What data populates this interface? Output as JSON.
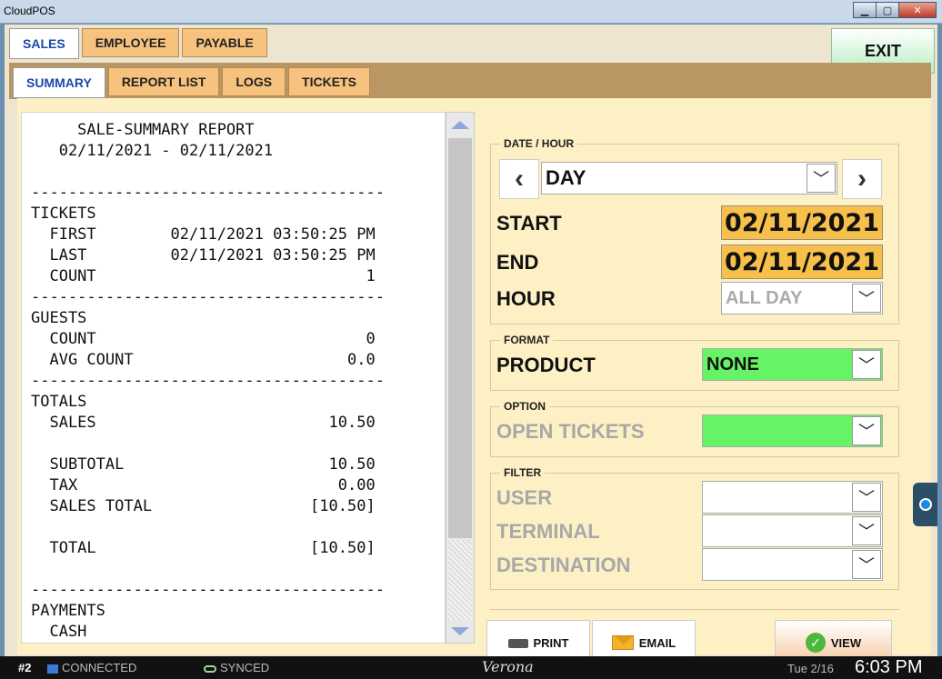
{
  "window": {
    "title": "CloudPOS"
  },
  "top_tabs": [
    {
      "label": "SALES",
      "active": true
    },
    {
      "label": "EMPLOYEE",
      "active": false
    },
    {
      "label": "PAYABLE",
      "active": false
    }
  ],
  "exit_label": "EXIT",
  "sub_tabs": [
    {
      "label": "SUMMARY",
      "active": true
    },
    {
      "label": "REPORT LIST",
      "active": false
    },
    {
      "label": "LOGS",
      "active": false
    },
    {
      "label": "TICKETS",
      "active": false
    }
  ],
  "report": {
    "lines": [
      "     SALE-SUMMARY REPORT",
      "   02/11/2021 - 02/11/2021",
      "",
      "--------------------------------------",
      "TICKETS",
      "  FIRST        02/11/2021 03:50:25 PM",
      "  LAST         02/11/2021 03:50:25 PM",
      "  COUNT                             1",
      "--------------------------------------",
      "GUESTS",
      "  COUNT                             0",
      "  AVG COUNT                       0.0",
      "--------------------------------------",
      "TOTALS",
      "  SALES                         10.50",
      "",
      "  SUBTOTAL                      10.50",
      "  TAX                            0.00",
      "  SALES TOTAL                 [10.50]",
      "",
      "  TOTAL                       [10.50]",
      "",
      "--------------------------------------",
      "PAYMENTS",
      "  CASH"
    ]
  },
  "date_hour": {
    "legend": "DATE / HOUR",
    "period": "DAY",
    "start_label": "START",
    "start_value": "02/11/2021",
    "end_label": "END",
    "end_value": "02/11/2021",
    "hour_label": "HOUR",
    "hour_value": "ALL DAY"
  },
  "format": {
    "legend": "FORMAT",
    "product_label": "PRODUCT",
    "product_value": "NONE"
  },
  "option": {
    "legend": "OPTION",
    "open_tickets_label": "OPEN TICKETS",
    "open_tickets_value": ""
  },
  "filter": {
    "legend": "FILTER",
    "user_label": "USER",
    "terminal_label": "TERMINAL",
    "destination_label": "DESTINATION"
  },
  "actions": {
    "print_label": "PRINT",
    "email_label": "EMAIL",
    "view_label": "VIEW"
  },
  "status": {
    "terminal": "#2",
    "connection": "CONNECTED",
    "sync": "SYNCED",
    "location": "Verona",
    "date": "Tue 2/16",
    "time": "6:03 PM"
  },
  "colors": {
    "accent_blue": "#1c49a8",
    "tab_orange": "#f6c27e",
    "date_yellow": "#f7c04a",
    "select_green": "#66f466",
    "content_bg": "#fdf0c4"
  }
}
